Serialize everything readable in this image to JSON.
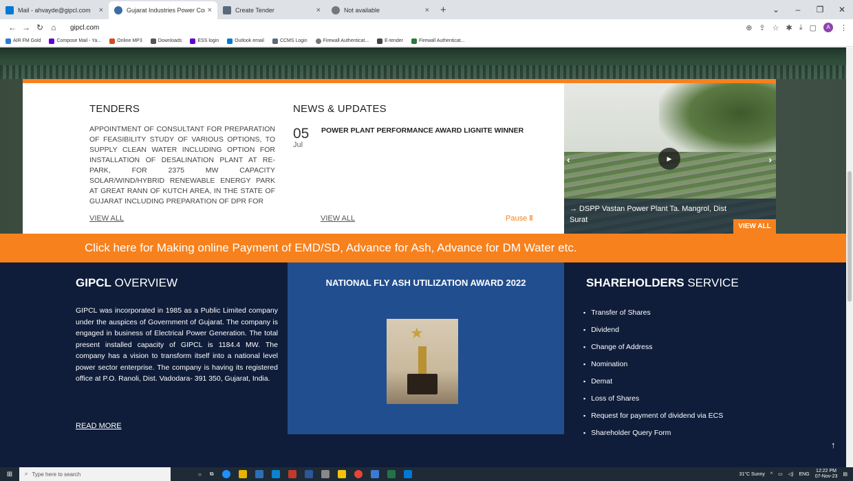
{
  "browser": {
    "tabs": [
      {
        "title": "Mail - ahvayde@gipcl.com",
        "favicon_color": "#0078d4"
      },
      {
        "title": "Gujarat Industries Power Compa",
        "favicon_color": "#3a6ea5",
        "active": true
      },
      {
        "title": "Create Tender",
        "favicon_color": "#5a6a7a"
      },
      {
        "title": "Not available",
        "favicon_color": "#777777"
      }
    ],
    "url": "gipcl.com",
    "profile_initial": "A",
    "bookmarks": [
      {
        "label": "AIR FM Gold",
        "color": "#2b7bd3"
      },
      {
        "label": "Compose Mail - Ya...",
        "color": "#6001d2"
      },
      {
        "label": "Online MP3",
        "color": "#d34b1f"
      },
      {
        "label": "Downloads",
        "color": "#555555"
      },
      {
        "label": "ESS login",
        "color": "#6001d2"
      },
      {
        "label": "Outlook email",
        "color": "#0078d4"
      },
      {
        "label": "CCMS Login",
        "color": "#5a6a7a"
      },
      {
        "label": "Firewall Authenticat...",
        "color": "#777777"
      },
      {
        "label": "E-tender",
        "color": "#444444"
      },
      {
        "label": "Firewall Authenticat...",
        "color": "#2c7a3a"
      }
    ]
  },
  "tenders": {
    "title": "TENDERS",
    "text": "APPOINTMENT OF CONSULTANT FOR PREPARATION OF FEASIBILITY STUDY OF VARIOUS OPTIONS, TO SUPPLY CLEAN WATER INCLUDING OPTION FOR INSTALLATION OF DESALINATION PLANT AT RE-PARK, FOR 2375 MW CAPACITY SOLAR/WIND/HYBRID RENEWABLE ENERGY PARK AT GREAT RANN OF KUTCH AREA, IN THE STATE OF GUJARAT INCLUDING PREPARATION OF DPR FOR",
    "view_all": "VIEW ALL"
  },
  "news": {
    "title": "NEWS & UPDATES",
    "day": "05",
    "month": "Jul",
    "headline": "POWER PLANT PERFORMANCE AWARD LIGNITE WINNER",
    "view_all": "VIEW ALL",
    "pause": "Pause"
  },
  "slider": {
    "caption": "→ DSPP Vastan Power Plant Ta. Mangrol, Dist Surat",
    "view_all": "VIEW ALL"
  },
  "banner": {
    "text": "Click here for Making online Payment of EMD/SD, Advance for Ash, Advance for DM Water etc."
  },
  "overview": {
    "title_bold": "GIPCL",
    "title_rest": " OVERVIEW",
    "text": "GIPCL was incorporated in 1985 as a Public Limited company under the auspices of Government of Gujarat. The company is engaged in business of Electrical Power Generation. The total present installed capacity of GIPCL is 1184.4 MW. The company has a vision to transform itself into a national level power sector enterprise. The company is having its registered office at P.O. Ranoli, Dist. Vadodara- 391 350, Gujarat, India.",
    "read_more": "READ MORE"
  },
  "award": {
    "title": "NATIONAL FLY ASH UTILIZATION AWARD 2022"
  },
  "shareholders": {
    "title_bold": "SHAREHOLDERS",
    "title_rest": " SERVICE",
    "items": [
      "Transfer of Shares",
      "Dividend",
      "Change of Address",
      "Nomination",
      "Demat",
      "Loss of Shares",
      "Request for payment of dividend via ECS",
      "Shareholder Query Form"
    ]
  },
  "taskbar": {
    "search_placeholder": "Type here to search",
    "weather": "31°C Sunny",
    "lang": "ENG",
    "time": "12:22 PM",
    "date": "07-Nov-23"
  },
  "colors": {
    "accent_orange": "#f7811d",
    "navy": "#0f1d3a",
    "award_blue": "#214e8f"
  }
}
